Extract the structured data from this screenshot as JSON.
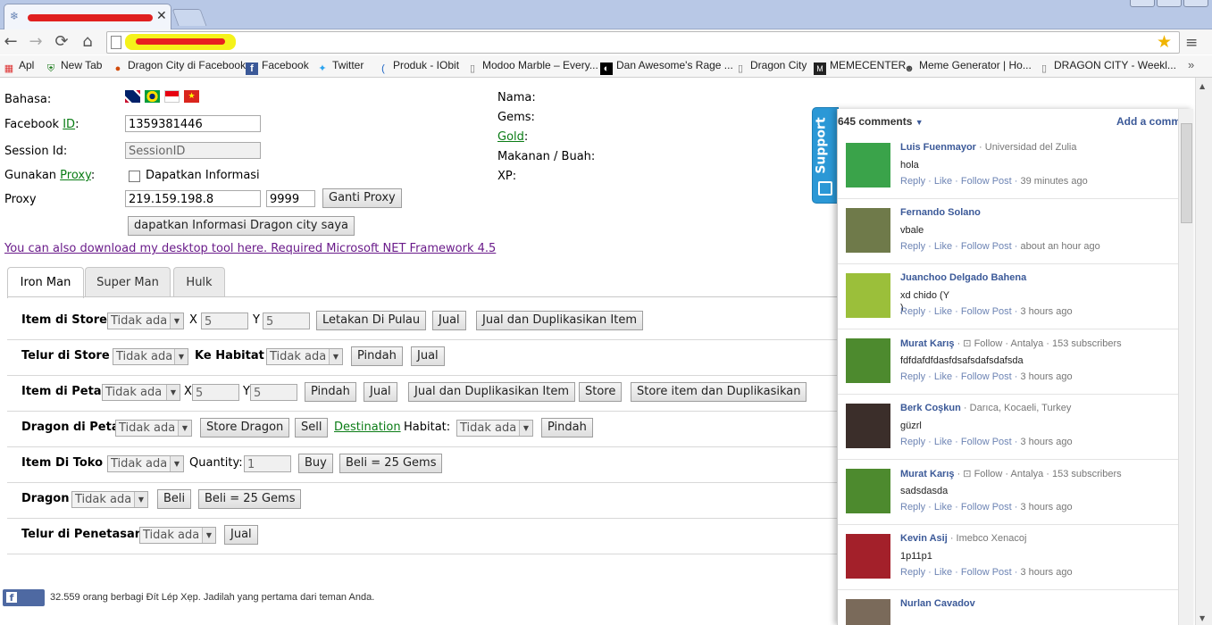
{
  "browser": {
    "back": "←",
    "forward": "→",
    "reload": "⟳",
    "home": "⌂",
    "star": "★",
    "menu": "≡",
    "bookmarks": [
      {
        "label": "Apl",
        "icon": "apps-icon"
      },
      {
        "label": "New Tab",
        "icon": "shield-icon"
      },
      {
        "label": "Dragon City di Facebook",
        "icon": "dragon-icon"
      },
      {
        "label": "Facebook",
        "icon": "facebook-icon"
      },
      {
        "label": "Twitter",
        "icon": "twitter-icon"
      },
      {
        "label": "Produk - IObit",
        "icon": "iobit-icon"
      },
      {
        "label": "Modoo Marble – Every...",
        "icon": "page-icon"
      },
      {
        "label": "Dan Awesome's Rage ...",
        "icon": "rage-icon"
      },
      {
        "label": "Dragon City",
        "icon": "page-icon"
      },
      {
        "label": "MEMECENTER",
        "icon": "memecenter-icon"
      },
      {
        "label": "Meme Generator | Ho...",
        "icon": "meme-icon"
      },
      {
        "label": "DRAGON CITY - Weekl...",
        "icon": "page-icon"
      }
    ],
    "more": "»"
  },
  "form": {
    "bahasa_label": "Bahasa:",
    "facebook_label": "Facebook ",
    "id_link": "ID",
    "colon": ":",
    "facebook_id": "1359381446",
    "session_label": "Session Id:",
    "session_placeholder": "SessionID",
    "gunakan_label": "Gunakan ",
    "proxy_link": "Proxy",
    "dapatkan_info": "Dapatkan Informasi",
    "proxy_label": "Proxy",
    "proxy_ip": "219.159.198.8",
    "proxy_port": "9999",
    "ganti_proxy": "Ganti Proxy",
    "get_info_button": "dapatkan Informasi Dragon city saya",
    "download_link": "You can also download my desktop tool here. Required Microsoft NET Framework 4.5"
  },
  "info": {
    "nama": "Nama:",
    "gems": "Gems:",
    "gold_link": "Gold",
    "gold_colon": ":",
    "makanan": "Makanan / Buah:",
    "xp": "XP:"
  },
  "tabs": [
    "Iron Man",
    "Super Man",
    "Hulk"
  ],
  "rows": {
    "item_store": {
      "label": "Item di Store",
      "select": "Tidak ada",
      "x": "X",
      "xval": "5",
      "y": "Y",
      "yval": "5",
      "b1": "Letakan Di Pulau",
      "b2": "Jual",
      "b3": "Jual dan Duplikasikan Item"
    },
    "telur_store": {
      "label": "Telur di Store",
      "select": "Tidak ada",
      "ke": "Ke Habitat",
      "select2": "Tidak ada",
      "b1": "Pindah",
      "b2": "Jual"
    },
    "item_peta": {
      "label": "Item di Peta",
      "select": "Tidak ada",
      "x": "X",
      "xval": "5",
      "y": "Y",
      "yval": "5",
      "b1": "Pindah",
      "b2": "Jual",
      "b3": "Jual dan Duplikasikan Item",
      "b4": "Store",
      "b5": "Store item dan Duplikasikan"
    },
    "dragon_peta": {
      "label": "Dragon di Peta",
      "select": "Tidak ada",
      "b1": "Store Dragon",
      "b2": "Sell",
      "dest_link": "Destination",
      "habitat": "Habitat:",
      "select2": "Tidak ada",
      "b3": "Pindah"
    },
    "item_toko": {
      "label": "Item Di Toko",
      "select": "Tidak ada",
      "qty_label": "Quantity:",
      "qty": "1",
      "b1": "Buy",
      "b2": "Beli = 25 Gems"
    },
    "dragon": {
      "label": "Dragon",
      "select": "Tidak ada",
      "b1": "Beli",
      "b2": "Beli = 25 Gems"
    },
    "telur_penetasan": {
      "label": "Telur di Penetasan",
      "select": "Tidak ada",
      "b1": "Jual"
    }
  },
  "footer": {
    "ikuti": "Ikuti",
    "text": "32.559 orang berbagi Đít Lép Xẹp. Jadilah yang pertama dari teman Anda."
  },
  "support": "Support",
  "comments": {
    "count": "645 comments",
    "add": "Add a comm",
    "items": [
      {
        "name": "Luis Fuenmayor",
        "meta": " · Universidad del Zulia",
        "text": "hola",
        "actions": "Reply · Like · Follow Post · ",
        "time": "39 minutes ago",
        "avatar": "#3aa34a"
      },
      {
        "name": "Fernando Solano",
        "meta": "",
        "text": "vbale",
        "actions": "Reply · Like · Follow Post · ",
        "time": "about an hour ago",
        "avatar": "#6f7a4a"
      },
      {
        "name": "Juanchoo Delgado Bahena",
        "meta": "",
        "text": "xd chido (Y\n)",
        "actions": "Reply · Like · Follow Post · ",
        "time": "3 hours ago",
        "avatar": "#9bbf3a"
      },
      {
        "name": "Murat Karış",
        "meta": " · ⊡ Follow · Antalya · 153 subscribers",
        "text": "fdfdafdfdasfdsafsdafsdafsda",
        "actions": "Reply · Like · Follow Post · ",
        "time": "3 hours ago",
        "avatar": "#4d8a2e"
      },
      {
        "name": "Berk Coşkun",
        "meta": " · Darıca, Kocaeli, Turkey",
        "text": "güzrl",
        "actions": "Reply · Like · Follow Post · ",
        "time": "3 hours ago",
        "avatar": "#3b2e2a"
      },
      {
        "name": "Murat Karış",
        "meta": " · ⊡ Follow · Antalya · 153 subscribers",
        "text": "sadsdasda",
        "actions": "Reply · Like · Follow Post · ",
        "time": "3 hours ago",
        "avatar": "#4d8a2e"
      },
      {
        "name": "Kevin Asij",
        "meta": " · Imebco Xenacoj",
        "text": "1p11p1",
        "actions": "Reply · Like · Follow Post · ",
        "time": "3 hours ago",
        "avatar": "#a3202a"
      },
      {
        "name": "Nurlan Cavadov",
        "meta": "",
        "text": "",
        "actions": "",
        "time": "",
        "avatar": "#7a6a5a"
      }
    ]
  }
}
